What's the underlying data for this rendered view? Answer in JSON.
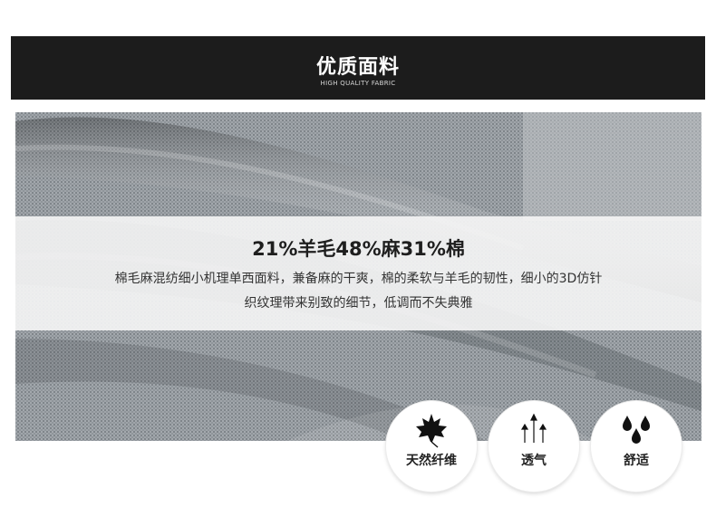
{
  "header": {
    "title": "优质面料",
    "subtitle": "HIGH QUALITY FABRIC"
  },
  "overlay": {
    "composition": "21%羊毛48%麻31%棉",
    "description_line1": "棉毛麻混纺细小机理单西面料，兼备麻的干爽，棉的柔软与羊毛的韧性，细小的3D仿针",
    "description_line2": "织纹理带来别致的细节，低调而不失典雅"
  },
  "features": [
    {
      "label": "天然纤维",
      "icon": "maple-leaf-icon"
    },
    {
      "label": "透气",
      "icon": "arrows-up-icon"
    },
    {
      "label": "舒适",
      "icon": "water-drops-icon"
    }
  ],
  "colors": {
    "header_bg": "#1c1c1c",
    "fabric": "#8e9398",
    "band": "#f6f6f6"
  }
}
